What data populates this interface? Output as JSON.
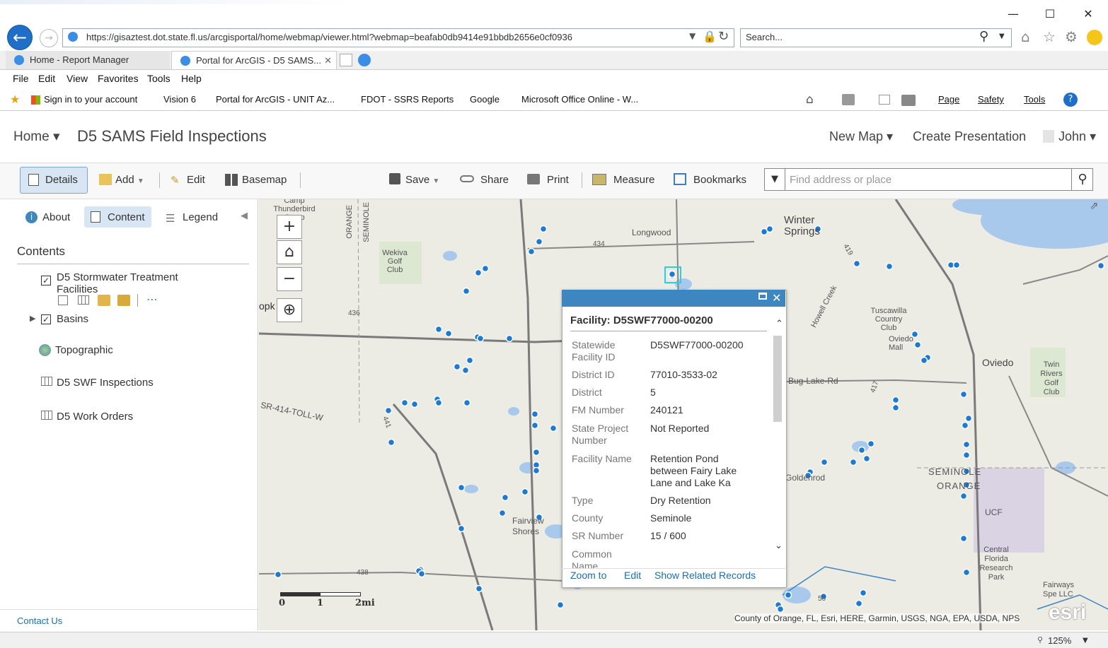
{
  "browser": {
    "url": "https://gisaztest.dot.state.fl.us/arcgisportal/home/webmap/viewer.html?webmap=beafab0db9414e91bbdb2656e0cf0936",
    "search_placeholder": "Search...",
    "tabs": [
      {
        "label": "Home - Report Manager"
      },
      {
        "label": "Portal for ArcGIS - D5 SAMS..."
      }
    ],
    "menu": [
      "File",
      "Edit",
      "View",
      "Favorites",
      "Tools",
      "Help"
    ],
    "favorites": [
      "Sign in to your account",
      "Vision 6",
      "Portal for ArcGIS - UNIT Az...",
      "FDOT - SSRS Reports",
      "Google",
      "Microsoft Office Online - W..."
    ],
    "commands": [
      "Page",
      "Safety",
      "Tools"
    ],
    "zoom": "125%"
  },
  "app": {
    "home": "Home",
    "title": "D5 SAMS Field Inspections",
    "new_map": "New Map",
    "create_presentation": "Create Presentation",
    "user": "John"
  },
  "toolbar": {
    "details": "Details",
    "add": "Add",
    "edit": "Edit",
    "basemap": "Basemap",
    "save": "Save",
    "share": "Share",
    "print": "Print",
    "measure": "Measure",
    "bookmarks": "Bookmarks",
    "find_placeholder": "Find address or place"
  },
  "panel": {
    "about": "About",
    "content": "Content",
    "legend": "Legend",
    "heading": "Contents",
    "layers": {
      "stormwater": "D5 Stormwater Treatment Facilities",
      "basins": "Basins",
      "topographic": "Topographic",
      "swf_inspections": "D5 SWF Inspections",
      "work_orders": "D5 Work Orders"
    },
    "contact": "Contact Us"
  },
  "map": {
    "labels": {
      "camp": "Camp Thunderbird Camp",
      "orange": "ORANGE",
      "seminole": "SEMINOLE",
      "wekiva": "Wekiva Golf Club",
      "longwood": "Longwood",
      "winter_springs": "Winter Springs",
      "tuscawilla": "Tuscawilla Country Club",
      "oviedo_mall": "Oviedo Mall",
      "oviedo": "Oviedo",
      "twin_rivers": "Twin Rivers Golf Club",
      "bug_lake": "Bug-Lake-Rd",
      "howell": "Howell Creek",
      "sr414": "SR-414-TOLL-W",
      "goldenrod": "Goldenrod",
      "seminole_bottom": "SEMINOLE",
      "orange_bottom": "ORANGE",
      "ucf": "UCF",
      "cfrp": "Central Florida Research Park",
      "fairview": "Fairview Shores",
      "fairways": "Fairways Spe LLC",
      "r434": "434",
      "r436": "436",
      "r438": "438",
      "r417": "417",
      "r419": "419",
      "r50": "50",
      "r441": "441",
      "opk": "opk"
    },
    "scale": {
      "zero": "0",
      "one": "1",
      "two": "2mi"
    },
    "attribution": "County of Orange, FL, Esri, HERE, Garmin, USGS, NGA, EPA, USDA, NPS",
    "esri": "esri"
  },
  "popup": {
    "title": "Facility: D5SWF77000-00200",
    "fields": [
      {
        "key": "Statewide Facility ID",
        "value": "D5SWF77000-00200"
      },
      {
        "key": "District ID",
        "value": "77010-3533-02"
      },
      {
        "key": "District",
        "value": "5"
      },
      {
        "key": "FM Number",
        "value": "240121"
      },
      {
        "key": "State Project Number",
        "value": "Not Reported"
      },
      {
        "key": "Facility Name",
        "value": "Retention Pond between Fairy Lake Lane and Lake Ka"
      },
      {
        "key": "Type",
        "value": "Dry Retention"
      },
      {
        "key": "County",
        "value": "Seminole"
      },
      {
        "key": "SR Number",
        "value": "15 / 600"
      },
      {
        "key": "Common Name",
        "value": ""
      }
    ],
    "zoom_to": "Zoom to",
    "edit": "Edit",
    "related": "Show Related Records"
  }
}
